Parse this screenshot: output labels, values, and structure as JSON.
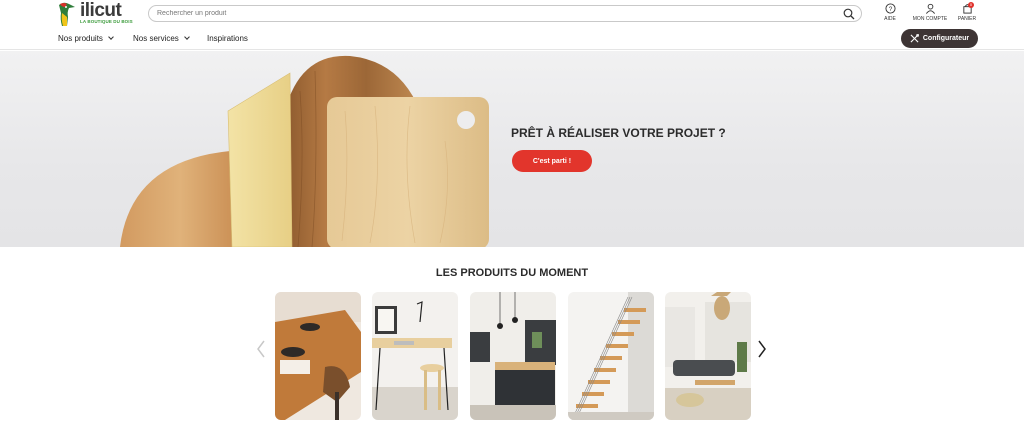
{
  "brand": {
    "name": "ilicut",
    "tagline": "LA BOUTIQUE DU BOIS"
  },
  "search": {
    "placeholder": "Rechercher un produit",
    "value": ""
  },
  "utilities": [
    {
      "label": "AIDE",
      "icon": "help-icon"
    },
    {
      "label": "MON COMPTE",
      "icon": "user-icon"
    },
    {
      "label": "PANIER",
      "icon": "bag-icon",
      "badge": "0"
    }
  ],
  "nav": {
    "items": [
      {
        "label": "Nos produits",
        "dropdown": true
      },
      {
        "label": "Nos services",
        "dropdown": true
      },
      {
        "label": "Inspirations",
        "dropdown": false
      }
    ],
    "configurator_label": "Configurateur"
  },
  "hero": {
    "title": "PRÊT À RÉALISER VOTRE PROJET ?",
    "cta_label": "C'est parti !"
  },
  "products": {
    "title": "LES PRODUITS DU MOMENT",
    "items": [
      {
        "image": "dining-table-photo"
      },
      {
        "image": "desk-photo"
      },
      {
        "image": "kitchen-photo"
      },
      {
        "image": "staircase-photo"
      },
      {
        "image": "living-room-photo"
      }
    ]
  },
  "colors": {
    "accent_red": "#e2352c",
    "dark_button": "#3d3434",
    "brand_green": "#3a9a3a"
  }
}
